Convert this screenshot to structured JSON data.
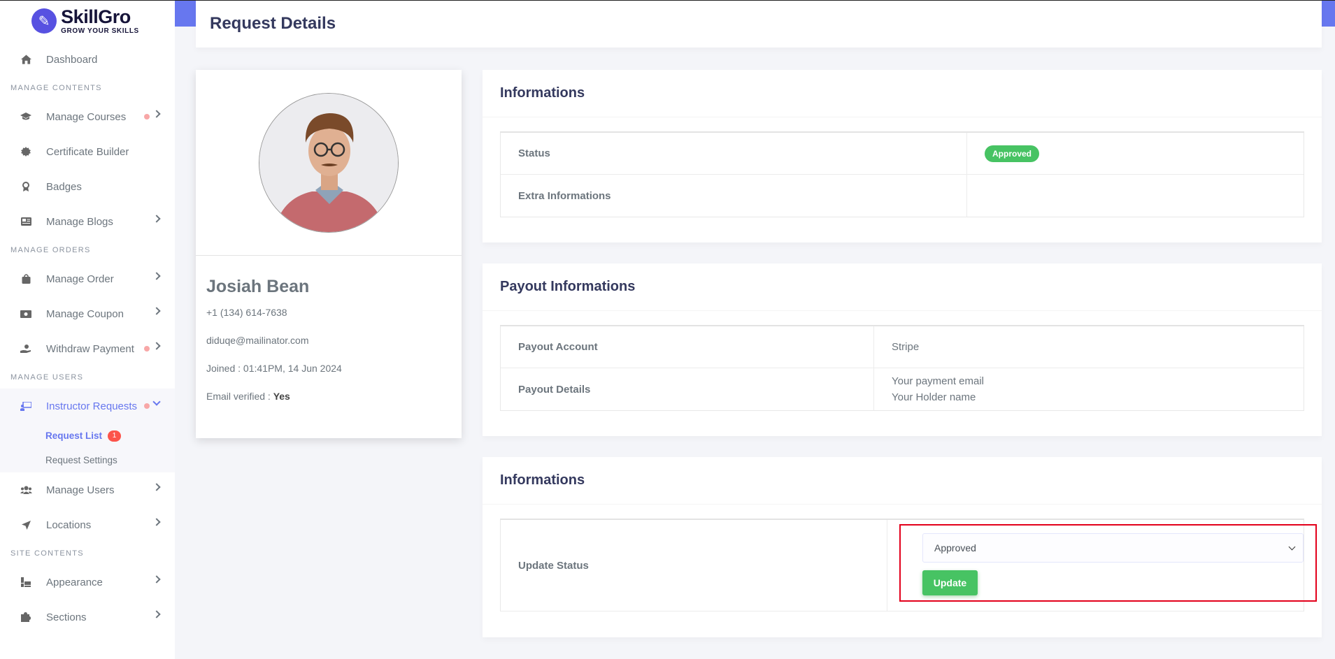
{
  "brand": {
    "name": "SkillGro",
    "tagline": "GROW YOUR SKILLS"
  },
  "sidebar": {
    "dashboard": "Dashboard",
    "sections": [
      {
        "header": "MANAGE CONTENTS",
        "items": [
          {
            "label": "Manage Courses",
            "icon": "graduation-cap-icon",
            "dot": true,
            "chevron": true
          },
          {
            "label": "Certificate Builder",
            "icon": "certificate-icon",
            "dot": false,
            "chevron": false
          },
          {
            "label": "Badges",
            "icon": "award-icon",
            "dot": false,
            "chevron": false
          },
          {
            "label": "Manage Blogs",
            "icon": "newspaper-icon",
            "dot": false,
            "chevron": true
          }
        ]
      },
      {
        "header": "MANAGE ORDERS",
        "items": [
          {
            "label": "Manage Order",
            "icon": "shopping-bag-icon",
            "dot": false,
            "chevron": true
          },
          {
            "label": "Manage Coupon",
            "icon": "money-bill-icon",
            "dot": false,
            "chevron": true
          },
          {
            "label": "Withdraw Payment",
            "icon": "hand-holding-dollar-icon",
            "dot": true,
            "chevron": true
          }
        ]
      },
      {
        "header": "MANAGE USERS",
        "items": [
          {
            "label": "Instructor Requests",
            "icon": "chalkboard-user-icon",
            "dot": true,
            "chevron": true,
            "active": true,
            "children": [
              {
                "label": "Request List",
                "badge": "1",
                "active": true
              },
              {
                "label": "Request Settings"
              }
            ]
          },
          {
            "label": "Manage Users",
            "icon": "users-icon",
            "dot": false,
            "chevron": true
          },
          {
            "label": "Locations",
            "icon": "location-arrow-icon",
            "dot": false,
            "chevron": true
          }
        ]
      },
      {
        "header": "SITE CONTENTS",
        "items": [
          {
            "label": "Appearance",
            "icon": "paint-roller-icon",
            "dot": false,
            "chevron": true
          },
          {
            "label": "Sections",
            "icon": "puzzle-piece-icon",
            "dot": false,
            "chevron": true
          }
        ]
      }
    ]
  },
  "page": {
    "title": "Request Details"
  },
  "profile": {
    "name": "Josiah Bean",
    "phone": "+1 (134) 614-7638",
    "email": "diduqe@mailinator.com",
    "joined": "Joined : 01:41PM, 14 Jun 2024",
    "email_verified_label": "Email verified : ",
    "email_verified_value": "Yes"
  },
  "info_card": {
    "title": "Informations",
    "status_label": "Status",
    "status_value": "Approved",
    "extra_label": "Extra Informations",
    "extra_value": ""
  },
  "payout_card": {
    "title": "Payout Informations",
    "account_label": "Payout Account",
    "account_value": "Stripe",
    "details_label": "Payout Details",
    "details_line1": "Your payment email",
    "details_line2": "Your Holder name"
  },
  "update_card": {
    "title": "Informations",
    "label": "Update Status",
    "selected": "Approved",
    "button": "Update"
  },
  "colors": {
    "primary": "#6777ef",
    "success": "#47c363",
    "danger": "#fc544b",
    "highlight": "#e3001b"
  }
}
